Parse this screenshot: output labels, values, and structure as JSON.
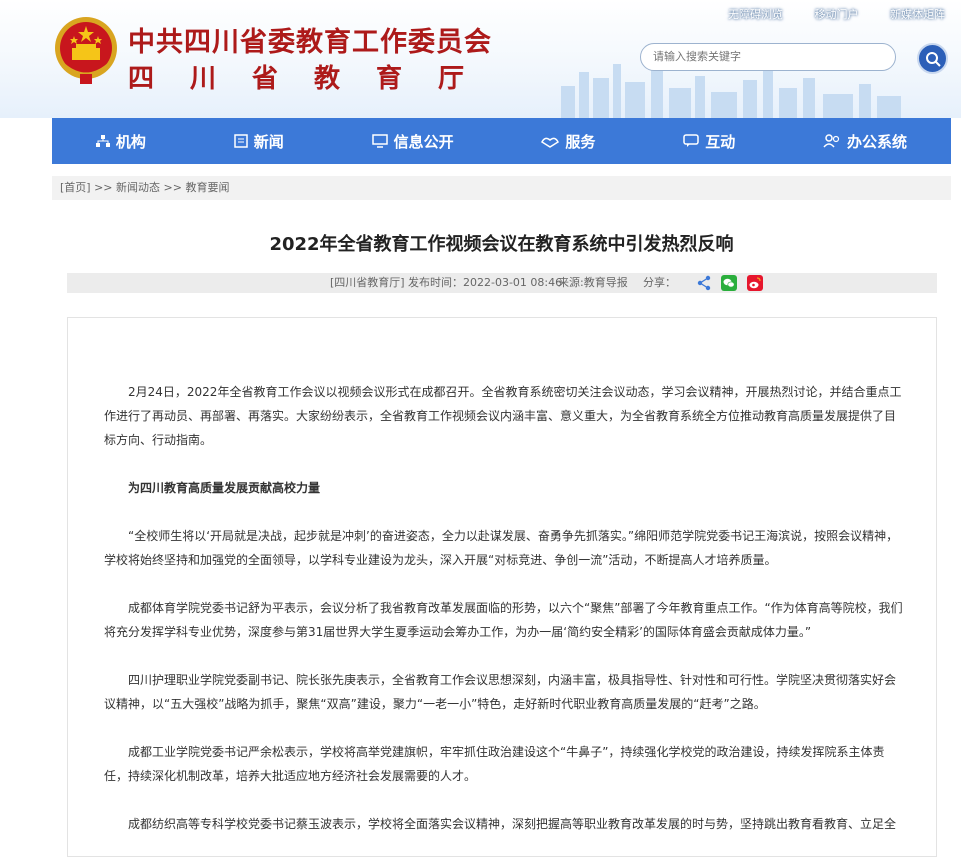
{
  "top_links": [
    "无障碍浏览",
    "移动门户",
    "新媒体矩阵"
  ],
  "header": {
    "title_line1": "中共四川省委教育工作委员会",
    "title_line2": "四川省教育厅"
  },
  "search": {
    "placeholder": "请输入搜索关键字"
  },
  "nav": [
    {
      "label": "机构",
      "icon": "org-icon"
    },
    {
      "label": "新闻",
      "icon": "news-icon"
    },
    {
      "label": "信息公开",
      "icon": "monitor-icon"
    },
    {
      "label": "服务",
      "icon": "service-icon"
    },
    {
      "label": "互动",
      "icon": "chat-icon"
    },
    {
      "label": "办公系统",
      "icon": "users-icon"
    }
  ],
  "breadcrumb": [
    "[首页]",
    "新闻动态",
    "教育要闻"
  ],
  "breadcrumb_sep": ">>",
  "article": {
    "title": "2022年全省教育工作视频会议在教育系统中引发热烈反响",
    "source_tag": "[四川省教育厅]",
    "publish_time": "发布时间：2022-03-01 08:46",
    "source": "来源:教育导报",
    "share_label": "分享：",
    "paragraphs": [
      {
        "text": "2月24日，2022年全省教育工作会议以视频会议形式在成都召开。全省教育系统密切关注会议动态，学习会议精神，开展热烈讨论，并结合重点工作进行了再动员、再部署、再落实。大家纷纷表示，全省教育工作视频会议内涵丰富、意义重大，为全省教育系统全方位推动教育高质量发展提供了目标方向、行动指南。",
        "bold": false
      },
      {
        "text": "为四川教育高质量发展贡献高校力量",
        "bold": true
      },
      {
        "text": "“全校师生将以‘开局就是决战，起步就是冲刺’的奋进姿态，全力以赴谋发展、奋勇争先抓落实。”绵阳师范学院党委书记王海滨说，按照会议精神，学校将始终坚持和加强党的全面领导，以学科专业建设为龙头，深入开展“对标竞进、争创一流”活动，不断提高人才培养质量。",
        "bold": false
      },
      {
        "text": "成都体育学院党委书记舒为平表示，会议分析了我省教育改革发展面临的形势，以六个“聚焦”部署了今年教育重点工作。“作为体育高等院校，我们将充分发挥学科专业优势，深度参与第31届世界大学生夏季运动会筹办工作，为办一届‘简约安全精彩’的国际体育盛会贡献成体力量。”",
        "bold": false
      },
      {
        "text": "四川护理职业学院党委副书记、院长张先庚表示，全省教育工作会议思想深刻，内涵丰富，极具指导性、针对性和可行性。学院坚决贯彻落实好会议精神，以“五大强校”战略为抓手，聚焦“双高”建设，聚力“一老一小”特色，走好新时代职业教育高质量发展的“赶考”之路。",
        "bold": false
      },
      {
        "text": "成都工业学院党委书记严余松表示，学校将高举党建旗帜，牢牢抓住政治建设这个“牛鼻子”，持续强化学校党的政治建设，持续发挥院系主体责任，持续深化机制改革，培养大批适应地方经济社会发展需要的人才。",
        "bold": false
      },
      {
        "text": "成都纺织高等专科学校党委书记蔡玉波表示，学校将全面落实会议精神，深刻把握高等职业教育改革发展的时与势，坚持跳出教育看教育、立足全",
        "bold": false
      }
    ]
  },
  "colors": {
    "nav_bg": "#3c79d8",
    "title_red": "#ad1a1a",
    "wechat": "#2aae3c",
    "weibo": "#e6162d"
  }
}
